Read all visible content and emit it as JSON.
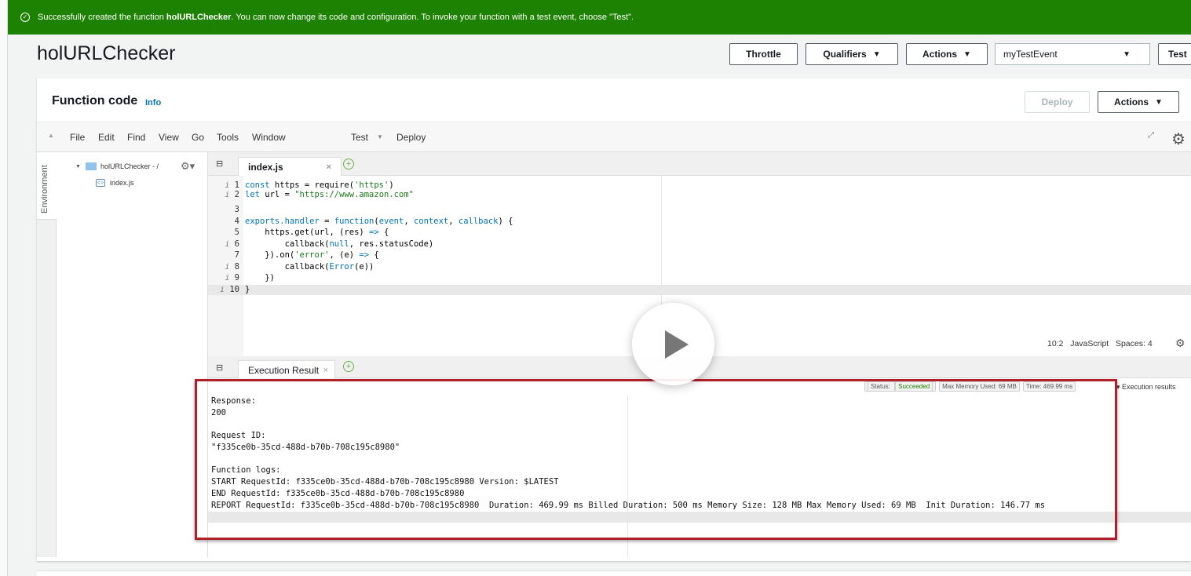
{
  "banner": {
    "prefix": "Successfully created the function ",
    "function_name": "holURLChecker",
    "suffix": ". You can now change its code and configuration. To invoke your function with a test event, choose \"Test\"."
  },
  "header": {
    "title": "holURLChecker",
    "throttle": "Throttle",
    "qualifiers": "Qualifiers",
    "actions": "Actions",
    "test_event": "myTestEvent",
    "test": "Test"
  },
  "function_code": {
    "title": "Function code",
    "info": "Info",
    "deploy": "Deploy",
    "actions": "Actions"
  },
  "ide_menu": {
    "items": [
      "File",
      "Edit",
      "Find",
      "View",
      "Go",
      "Tools",
      "Window"
    ],
    "test": "Test",
    "deploy": "Deploy"
  },
  "environment": {
    "label": "Environment",
    "folder": "holURLChecker - /",
    "file": "index.js"
  },
  "editor": {
    "tab": "index.js",
    "lines": [
      {
        "n": "1",
        "info": true
      },
      {
        "n": "2",
        "info": true
      },
      {
        "n": "3",
        "info": false
      },
      {
        "n": "4",
        "info": false
      },
      {
        "n": "5",
        "info": false
      },
      {
        "n": "6",
        "info": true
      },
      {
        "n": "7",
        "info": false
      },
      {
        "n": "8",
        "info": true
      },
      {
        "n": "9",
        "info": true
      },
      {
        "n": "10",
        "info": true
      }
    ],
    "status": "10:2   JavaScript   Spaces: 4"
  },
  "execution": {
    "tab": "Execution Result",
    "status_label": "Status: ",
    "status_value": "Succeeded",
    "max_memory": "Max Memory Used: 69 MB",
    "time": "Time: 469.99 ms",
    "results_toggle": "▾ Execution results",
    "output": [
      "Response:",
      "200",
      "",
      "Request ID:",
      "\"f335ce0b-35cd-488d-b70b-708c195c8980\"",
      "",
      "Function logs:",
      "START RequestId: f335ce0b-35cd-488d-b70b-708c195c8980 Version: $LATEST",
      "END RequestId: f335ce0b-35cd-488d-b70b-708c195c8980",
      "REPORT RequestId: f335ce0b-35cd-488d-b70b-708c195c8980  Duration: 469.99 ms Billed Duration: 500 ms Memory Size: 128 MB Max Memory Used: 69 MB  Init Duration: 146.77 ms"
    ]
  },
  "colors": {
    "success": "#1d8102",
    "highlight_box": "#b0202a",
    "link": "#0073bb"
  }
}
